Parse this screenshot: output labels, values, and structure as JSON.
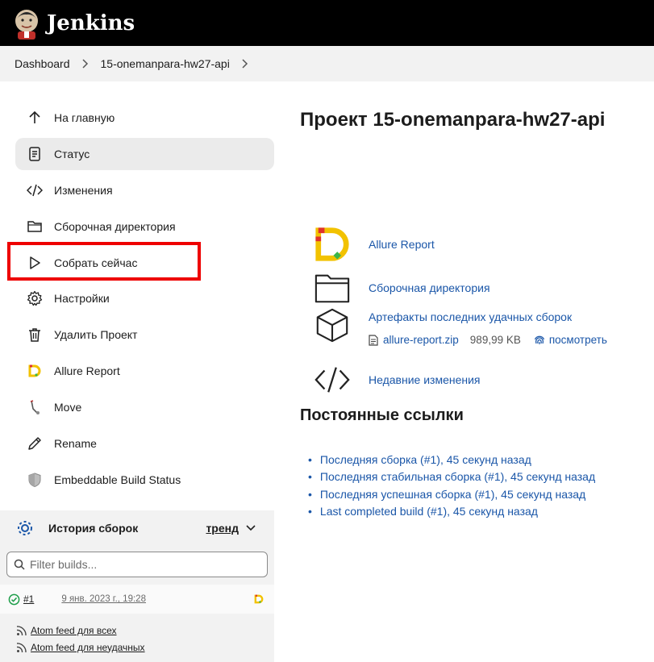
{
  "header": {
    "brand": "Jenkins"
  },
  "breadcrumb": {
    "items": [
      "Dashboard",
      "15-onemanpara-hw27-api"
    ]
  },
  "sidebar": {
    "items": [
      {
        "label": "На главную",
        "icon": "arrow-up-icon"
      },
      {
        "label": "Статус",
        "icon": "document-icon",
        "active": true
      },
      {
        "label": "Изменения",
        "icon": "code-icon"
      },
      {
        "label": "Сборочная директория",
        "icon": "folder-icon"
      },
      {
        "label": "Собрать сейчас",
        "icon": "play-icon",
        "highlighted": true
      },
      {
        "label": "Настройки",
        "icon": "gear-icon"
      },
      {
        "label": "Удалить Проект",
        "icon": "trash-icon"
      },
      {
        "label": "Allure Report",
        "icon": "allure-icon"
      },
      {
        "label": "Move",
        "icon": "move-icon"
      },
      {
        "label": "Rename",
        "icon": "pencil-icon"
      },
      {
        "label": "Embeddable Build Status",
        "icon": "shield-icon"
      }
    ]
  },
  "history": {
    "title": "История сборок",
    "trend": "тренд",
    "filter_placeholder": "Filter builds...",
    "builds": [
      {
        "number": "#1",
        "date": "9 янв. 2023 г., 19:28",
        "status": "success"
      }
    ],
    "feeds": [
      "Atom feed для всех",
      "Atom feed для неудачных"
    ]
  },
  "main": {
    "title": "Проект 15-onemanpara-hw27-api",
    "links": {
      "allure": "Allure Report",
      "workspace": "Сборочная директория",
      "artifacts": "Артефакты последних удачных сборок",
      "changes": "Недавние изменения"
    },
    "artifact": {
      "file": "allure-report.zip",
      "size": "989,99 KB",
      "view": "посмотреть"
    },
    "permalinks_title": "Постоянные ссылки",
    "permalinks": [
      "Последняя сборка (#1), 45 секунд назад",
      "Последняя стабильная сборка (#1), 45 секунд назад",
      "Последняя успешная сборка (#1), 45 секунд назад",
      "Last completed build (#1), 45 секунд назад"
    ]
  },
  "colors": {
    "header_bg": "#000000",
    "link": "#1a56a8",
    "highlight": "#ee0000",
    "success": "#1e9e4a"
  }
}
